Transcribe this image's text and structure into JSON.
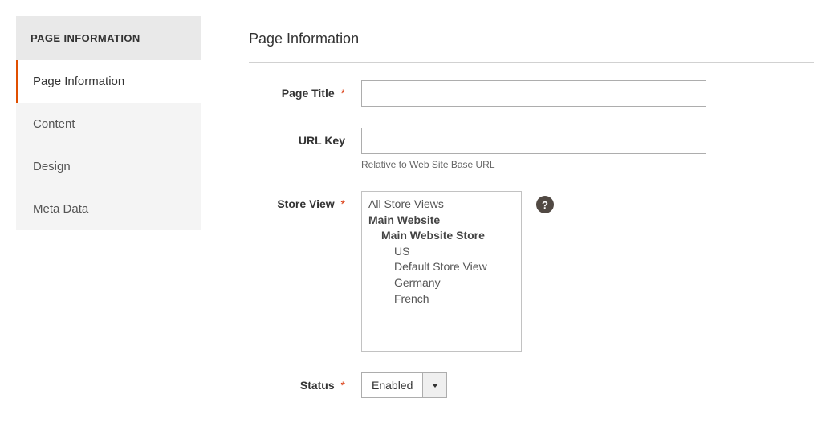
{
  "sidebar": {
    "header": "PAGE INFORMATION",
    "items": [
      {
        "label": "Page Information",
        "active": true
      },
      {
        "label": "Content",
        "active": false
      },
      {
        "label": "Design",
        "active": false
      },
      {
        "label": "Meta Data",
        "active": false
      }
    ]
  },
  "form": {
    "heading": "Page Information",
    "pageTitle": {
      "label": "Page Title",
      "required": "*",
      "value": ""
    },
    "urlKey": {
      "label": "URL Key",
      "value": "",
      "note": "Relative to Web Site Base URL"
    },
    "storeView": {
      "label": "Store View",
      "required": "*",
      "options": {
        "all": "All Store Views",
        "website": "Main Website",
        "store": "Main Website Store",
        "views": [
          {
            "label": "US"
          },
          {
            "label": "Default Store View"
          },
          {
            "label": "Germany"
          },
          {
            "label": "French"
          }
        ]
      },
      "helpGlyph": "?"
    },
    "status": {
      "label": "Status",
      "required": "*",
      "value": "Enabled"
    }
  }
}
